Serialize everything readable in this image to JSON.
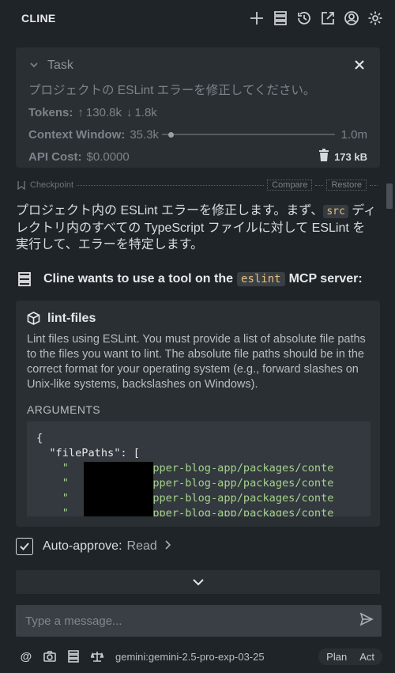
{
  "app": {
    "title": "CLINE"
  },
  "topbar_icons": [
    "plus-icon",
    "mcp-servers-icon",
    "history-icon",
    "popout-icon",
    "account-icon",
    "settings-icon"
  ],
  "task": {
    "header": "Task",
    "text": "プロジェクトの ESLint エラーを修正してください。",
    "tokens_label": "Tokens:",
    "tokens_up": "130.8k",
    "tokens_down": "1.8k",
    "context_label": "Context Window:",
    "context_used": "35.3k",
    "context_max": "1.0m",
    "context_fraction": 0.035,
    "api_cost_label": "API Cost:",
    "api_cost_value": "$0.0000",
    "size": "173 kB"
  },
  "checkpoint": {
    "label": "Checkpoint",
    "compare": "Compare",
    "restore": "Restore"
  },
  "message": {
    "part1": "プロジェクト内の ESLint エラーを修正します。まず、",
    "code": "src",
    "part2": " ディレクトリ内のすべての TypeScript ファイルに対して ESLint を実行して、エラーを特定します。"
  },
  "mcp": {
    "prefix": "Cline wants to use a tool on the",
    "server": "eslint",
    "suffix": "MCP server:"
  },
  "tool": {
    "name": "lint-files",
    "description": "Lint files using ESLint. You must provide a list of absolute file paths to the files you want to lint. The absolute file paths should be in the correct format for your operating system (e.g., forward slashes on Unix-like systems, backslashes on Windows).",
    "arguments_label": "ARGUMENTS",
    "code_line1": "{",
    "code_line2": "  \"filePaths\": [",
    "code_line3": "    \"          /sapper-blog-app/packages/conte",
    "code_line4": "    \"          /sapper-blog-app/packages/conte",
    "code_line5": "    \"          /sapper-blog-app/packages/conte",
    "code_line6": "    \"          /sapper-blog-app/packages/conte"
  },
  "auto_approve": {
    "label": "Auto-approve:",
    "value": "Read",
    "checked": true
  },
  "input": {
    "placeholder": "Type a message..."
  },
  "bottombar": {
    "model": "gemini:gemini-2.5-pro-exp-03-25",
    "plan": "Plan",
    "act": "Act"
  }
}
